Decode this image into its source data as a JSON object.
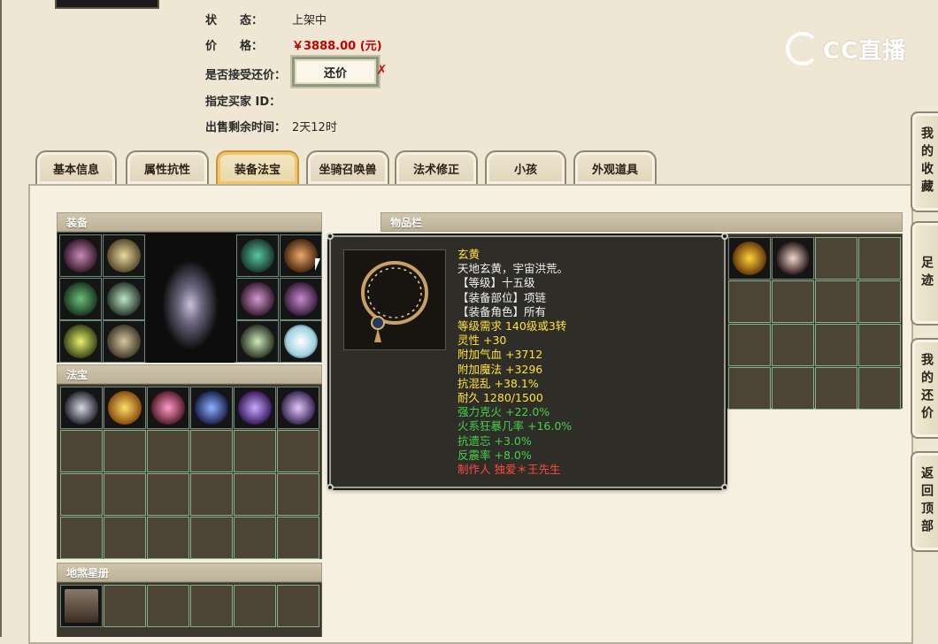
{
  "status_section": {
    "status_label": "状　　态：",
    "status_value": "上架中",
    "price_label": "价　　格：",
    "price_value": "￥3888.00 (元)",
    "counter_label": "是否接受还价：",
    "counter_button": "还价",
    "counter_mark": "✗",
    "buyer_label": "指定买家 ID：",
    "buyer_value": "",
    "time_label": "出售剩余时间：",
    "time_value": "2天12时"
  },
  "logo": {
    "text": "CC直播"
  },
  "tabs": [
    {
      "label": "基本信息"
    },
    {
      "label": "属性抗性"
    },
    {
      "label": "装备法宝",
      "active": true
    },
    {
      "label": "坐骑召唤兽"
    },
    {
      "label": "法术修正"
    },
    {
      "label": "小孩"
    },
    {
      "label": "外观道具"
    }
  ],
  "sections": {
    "equipment": "装备",
    "treasure": "法宝",
    "star_book": "地煞星册",
    "inventory": "物品栏"
  },
  "tooltip": {
    "name": "玄黄",
    "desc": "天地玄黄，宇宙洪荒。",
    "level": "【等级】十五级",
    "slot": "【装备部位】项链",
    "role": "【装备角色】所有",
    "req": "等级需求 140级或3转",
    "stat1": "灵性 +30",
    "stat2": "附加气血 +3712",
    "stat3": "附加魔法 +3296",
    "stat4": "抗混乱 +38.1%",
    "stat5": "耐久 1280/1500",
    "stat6": "强力克火 +22.0%",
    "stat7": "火系狂暴几率 +16.0%",
    "stat8": "抗遗忘 +3.0%",
    "stat9": "反震率 +8.0%",
    "maker": "制作人 独爱＊王先生"
  },
  "side_tabs": [
    {
      "label": "我的收藏"
    },
    {
      "label": "足迹"
    },
    {
      "label": "我的还价"
    },
    {
      "label": "返回顶部"
    }
  ],
  "colors": {
    "tooltip_name": "#ffe33f",
    "tooltip_green": "#46d14c",
    "tooltip_red": "#ff4a3c",
    "price": "#c40000"
  }
}
